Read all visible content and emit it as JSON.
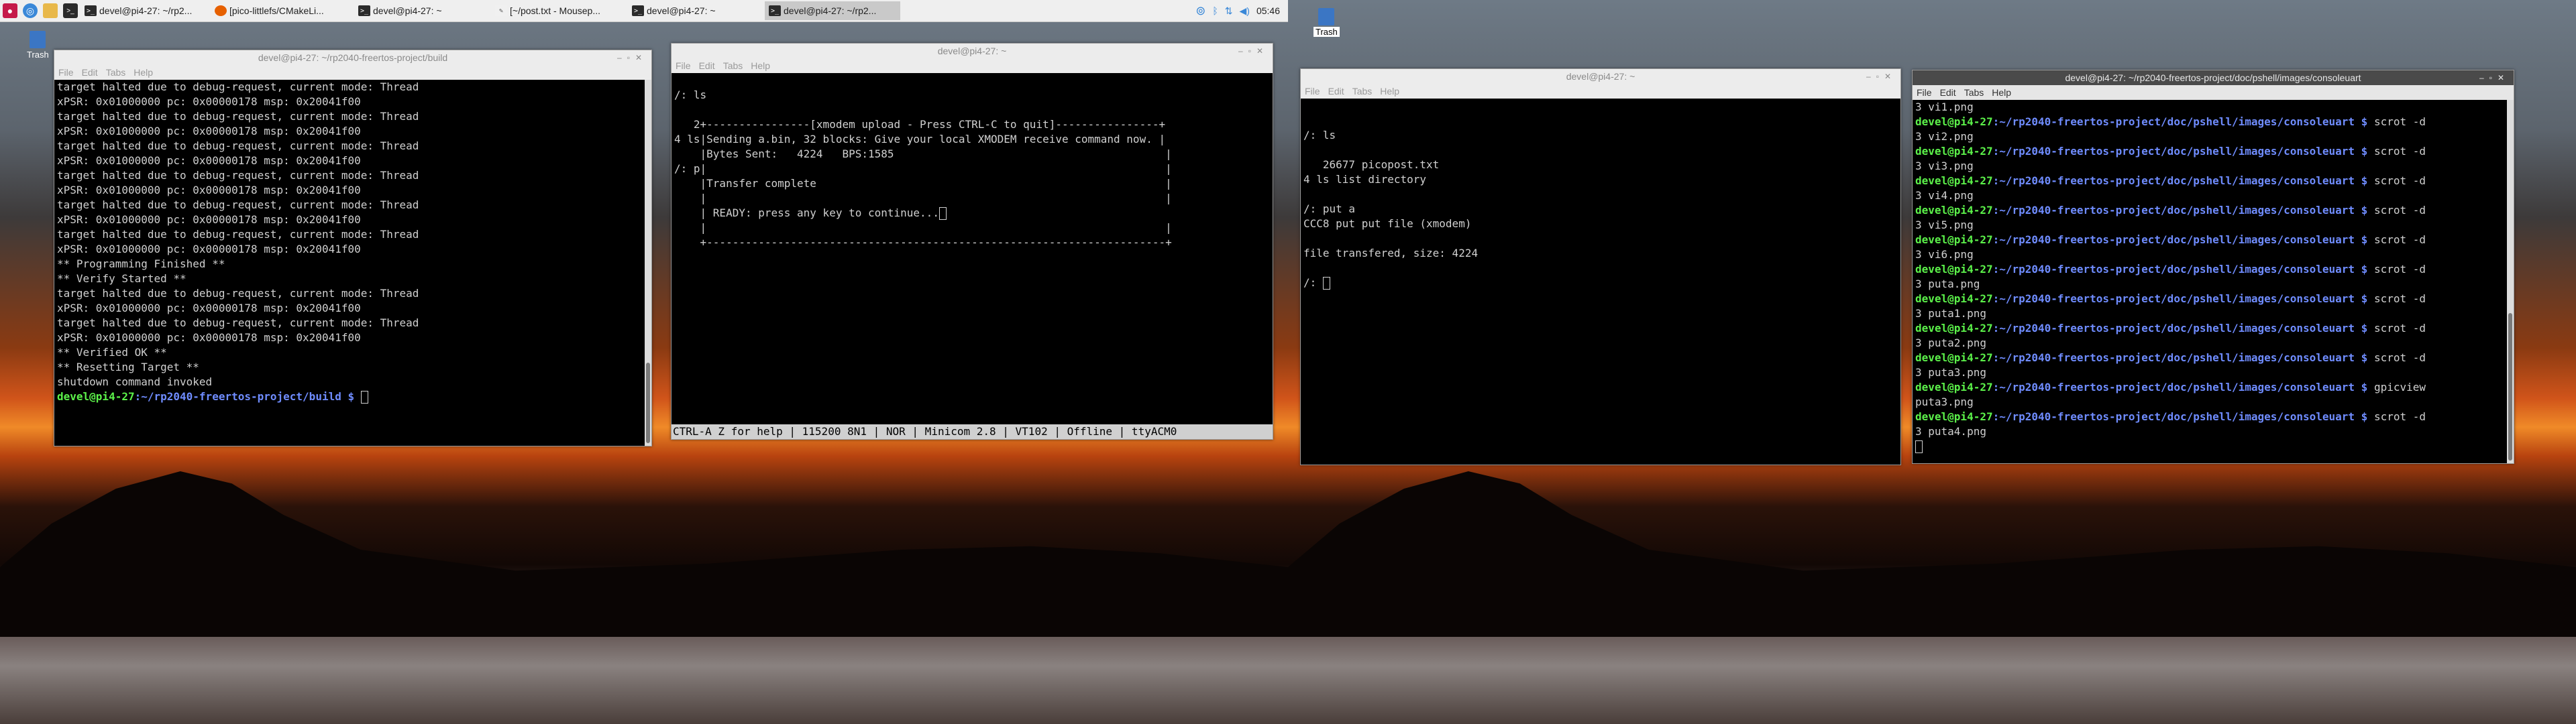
{
  "taskbar": {
    "tasks": [
      "devel@pi4-27: ~/rp2...",
      "[pico-littlefs/CMakeLi...",
      "devel@pi4-27: ~",
      "[~/post.txt - Mousep...",
      "devel@pi4-27: ~",
      "devel@pi4-27: ~/rp2..."
    ],
    "clock": "05:46"
  },
  "desktop": {
    "trash_label": "Trash"
  },
  "win1": {
    "title": "devel@pi4-27: ~/rp2040-freertos-project/build",
    "menu": [
      "File",
      "Edit",
      "Tabs",
      "Help"
    ],
    "lines": [
      "target halted due to debug-request, current mode: Thread",
      "xPSR: 0x01000000 pc: 0x00000178 msp: 0x20041f00",
      "target halted due to debug-request, current mode: Thread",
      "xPSR: 0x01000000 pc: 0x00000178 msp: 0x20041f00",
      "target halted due to debug-request, current mode: Thread",
      "xPSR: 0x01000000 pc: 0x00000178 msp: 0x20041f00",
      "target halted due to debug-request, current mode: Thread",
      "xPSR: 0x01000000 pc: 0x00000178 msp: 0x20041f00",
      "target halted due to debug-request, current mode: Thread",
      "xPSR: 0x01000000 pc: 0x00000178 msp: 0x20041f00",
      "target halted due to debug-request, current mode: Thread",
      "xPSR: 0x01000000 pc: 0x00000178 msp: 0x20041f00",
      "** Programming Finished **",
      "** Verify Started **",
      "target halted due to debug-request, current mode: Thread",
      "xPSR: 0x01000000 pc: 0x00000178 msp: 0x20041f00",
      "target halted due to debug-request, current mode: Thread",
      "xPSR: 0x01000000 pc: 0x00000178 msp: 0x20041f00",
      "** Verified OK **",
      "** Resetting Target **",
      "shutdown command invoked"
    ],
    "prompt_user": "devel@pi4-27",
    "prompt_path": ":~/rp2040-freertos-project/build $ "
  },
  "win2": {
    "title": "devel@pi4-27: ~",
    "menu": [
      "File",
      "Edit",
      "Tabs",
      "Help"
    ],
    "lines": [
      "",
      "/: ls",
      "",
      "   2+----------------[xmodem upload - Press CTRL-C to quit]----------------+",
      "4 ls|Sending a.bin, 32 blocks: Give your local XMODEM receive command now. |",
      "    |Bytes Sent:   4224   BPS:1585                                          |",
      "/: p|                                                                       |",
      "    |Transfer complete                                                      |",
      "    |                                                                       |",
      "    | READY: press any key to continue...                                   |",
      "    |                                                                       |",
      "    +-----------------------------------------------------------------------+"
    ],
    "status": "CTRL-A Z for help | 115200 8N1 | NOR | Minicom 2.8 | VT102 | Offline | ttyACM0"
  },
  "win3": {
    "title": "devel@pi4-27: ~",
    "menu": [
      "File",
      "Edit",
      "Tabs",
      "Help"
    ],
    "lines": [
      "",
      "",
      "/: ls",
      "",
      "   26677 picopost.txt",
      "4 ls list directory",
      "",
      "/: put a",
      "CCC8 put put file (xmodem)",
      "",
      "file transfered, size: 4224",
      "",
      "/: "
    ]
  },
  "win4": {
    "title": "devel@pi4-27: ~/rp2040-freertos-project/doc/pshell/images/consoleuart",
    "menu": [
      "File",
      "Edit",
      "Tabs",
      "Help"
    ],
    "user": "devel@pi4-27",
    "path": ":~/rp2040-freertos-project/doc/pshell/images/consoleuart $ ",
    "entries": [
      {
        "out": "3 vi1.png",
        "cmd": "scrot -d"
      },
      {
        "out": "3 vi2.png",
        "cmd": "scrot -d"
      },
      {
        "out": "3 vi3.png",
        "cmd": "scrot -d"
      },
      {
        "out": "3 vi4.png",
        "cmd": "scrot -d"
      },
      {
        "out": "3 vi5.png",
        "cmd": "scrot -d"
      },
      {
        "out": "3 vi6.png",
        "cmd": "scrot -d"
      },
      {
        "out": "3 puta.png",
        "cmd": "scrot -d"
      },
      {
        "out": "3 puta1.png",
        "cmd": "scrot -d"
      },
      {
        "out": "3 puta2.png",
        "cmd": "scrot -d"
      },
      {
        "out": "3 puta3.png",
        "cmd": "gpicview"
      },
      {
        "out": "puta3.png",
        "cmd": "scrot -d"
      }
    ],
    "last_line": "3 puta4.png"
  }
}
